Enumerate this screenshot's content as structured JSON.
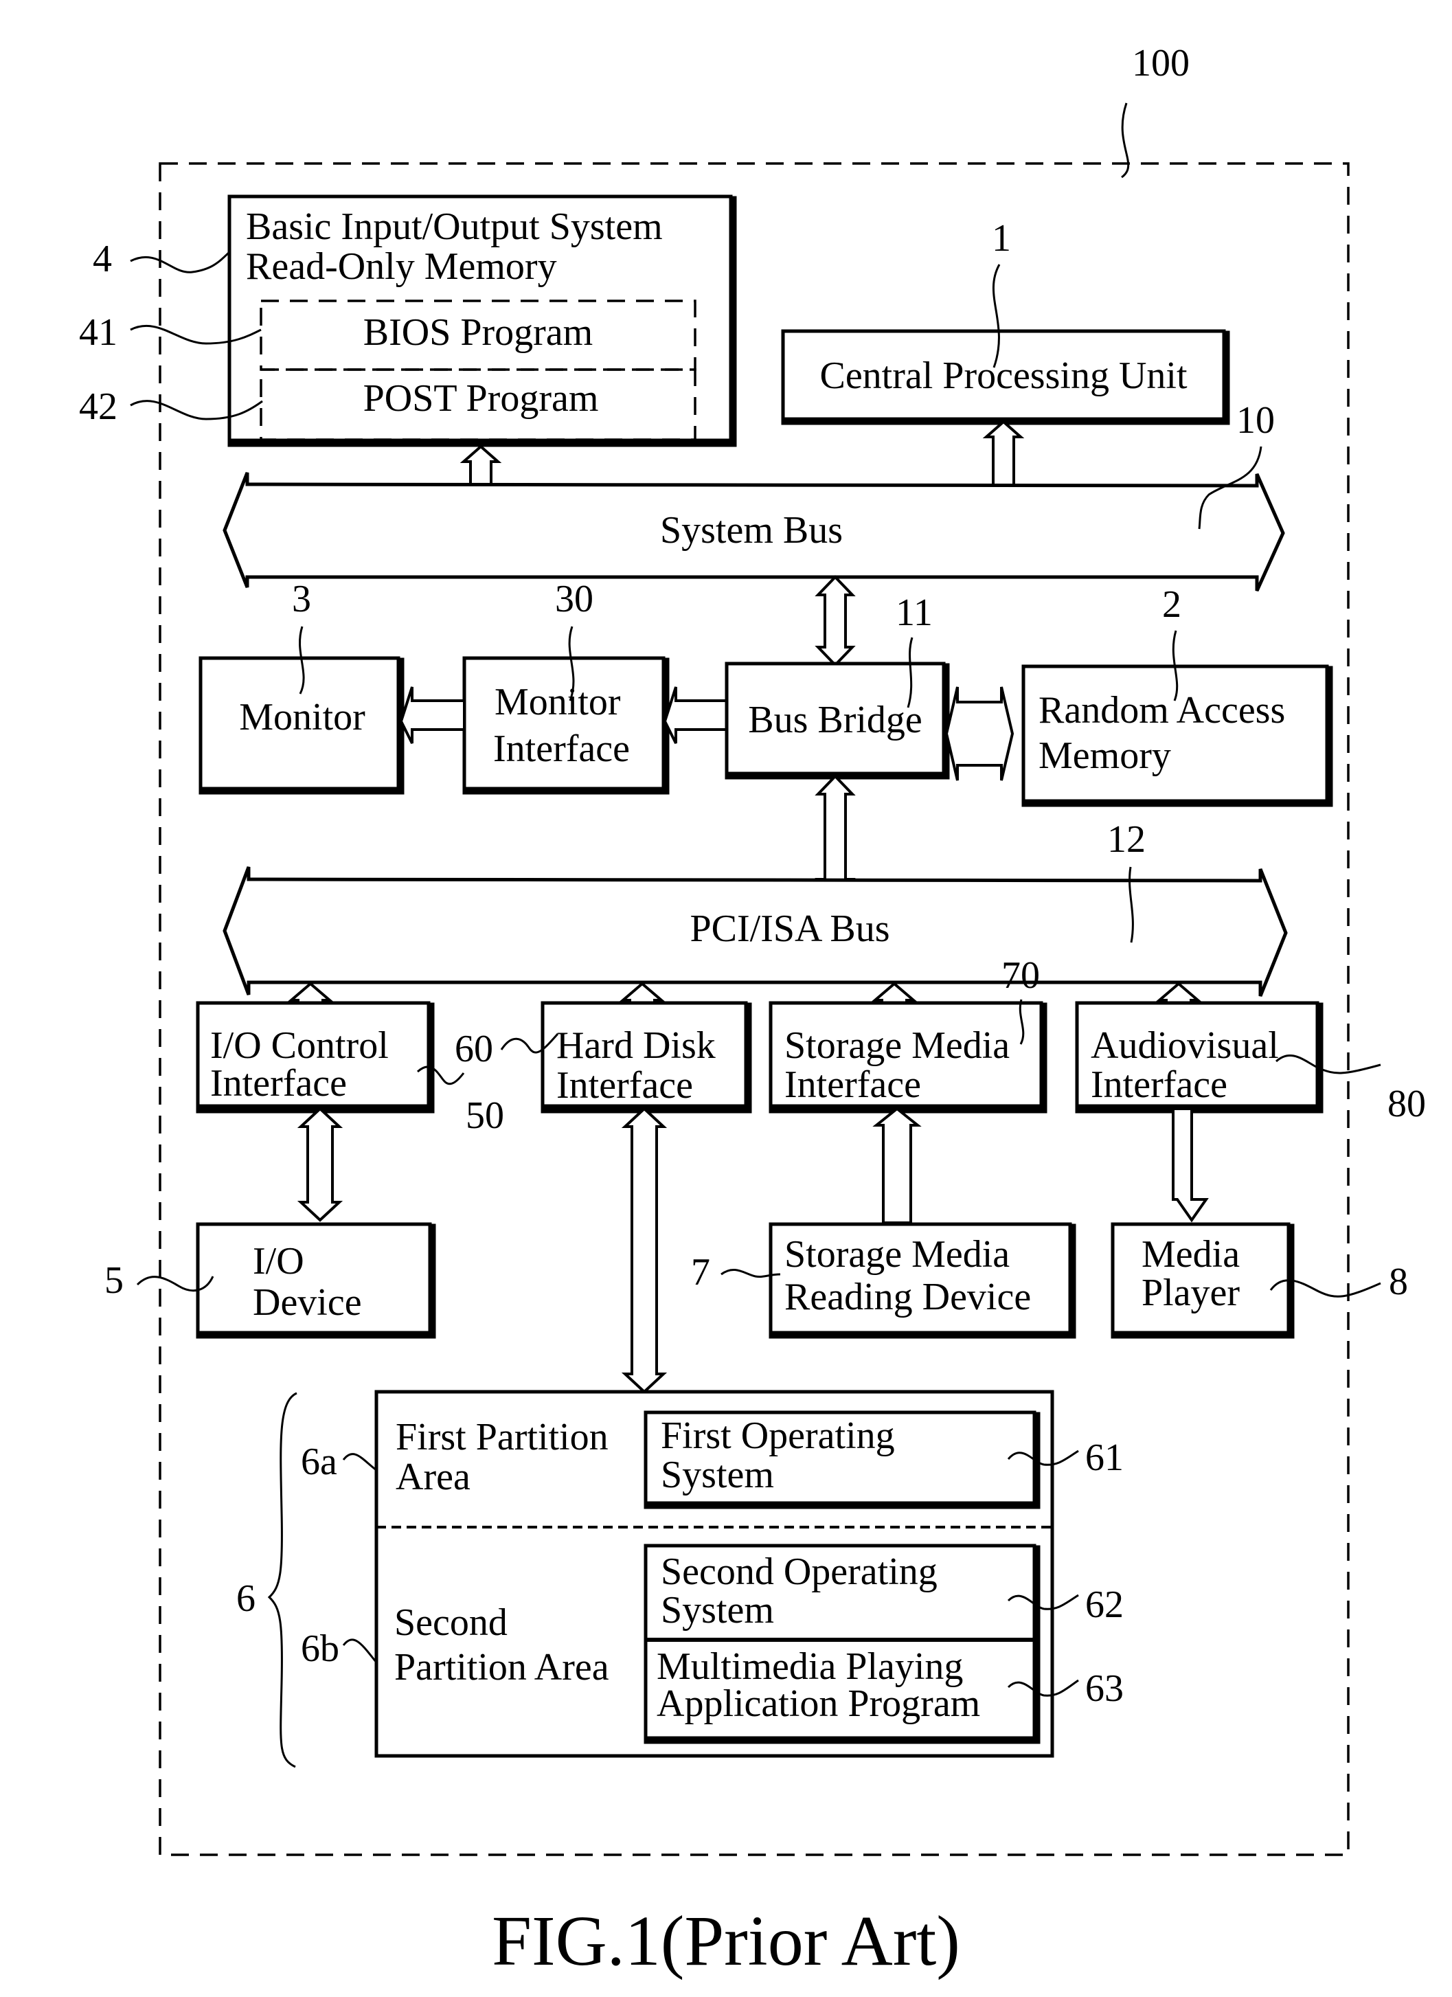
{
  "figure": {
    "caption": "FIG.1(Prior Art)",
    "system_ref": "100"
  },
  "blocks": {
    "bios_rom": {
      "ref": "4",
      "lines": [
        "Basic Input/Output System",
        "Read-Only Memory"
      ]
    },
    "bios_program": {
      "ref": "41",
      "label": "BIOS Program"
    },
    "post_program": {
      "ref": "42",
      "label": "POST Program"
    },
    "cpu": {
      "ref": "1",
      "label": "Central Processing Unit"
    },
    "system_bus": {
      "ref": "10",
      "label": "System Bus"
    },
    "monitor": {
      "ref": "3",
      "label": "Monitor"
    },
    "monitor_interface": {
      "ref": "30",
      "lines": [
        "Monitor",
        "Interface"
      ]
    },
    "bus_bridge": {
      "ref": "11",
      "label": "Bus Bridge"
    },
    "ram": {
      "ref": "2",
      "lines": [
        "Random Access",
        "Memory"
      ]
    },
    "pci_bus": {
      "ref": "12",
      "label": "PCI/ISA Bus"
    },
    "io_control": {
      "ref": "50",
      "lines": [
        "I/O Control",
        "Interface"
      ]
    },
    "hdd_interface": {
      "ref": "60",
      "lines": [
        "Hard Disk",
        "Interface"
      ]
    },
    "storage_interface": {
      "ref": "70",
      "lines": [
        "Storage Media",
        "Interface"
      ]
    },
    "av_interface": {
      "ref": "80",
      "lines": [
        "Audiovisual",
        "Interface"
      ]
    },
    "io_device": {
      "ref": "5",
      "lines": [
        "I/O",
        "Device"
      ]
    },
    "storage_reader": {
      "ref": "7",
      "lines": [
        "Storage Media",
        "Reading Device"
      ]
    },
    "media_player": {
      "ref": "8",
      "lines": [
        "Media",
        "Player"
      ]
    },
    "hard_disk": {
      "ref": "6"
    },
    "first_partition": {
      "ref": "6a",
      "lines": [
        "First Partition",
        "Area"
      ]
    },
    "second_partition": {
      "ref": "6b",
      "lines": [
        "Second",
        "Partition Area"
      ]
    },
    "first_os": {
      "ref": "61",
      "lines": [
        "First Operating",
        "System"
      ]
    },
    "second_os": {
      "ref": "62",
      "lines": [
        "Second Operating",
        "System"
      ]
    },
    "mm_app": {
      "ref": "63",
      "lines": [
        "Multimedia Playing",
        "Application Program"
      ]
    }
  }
}
